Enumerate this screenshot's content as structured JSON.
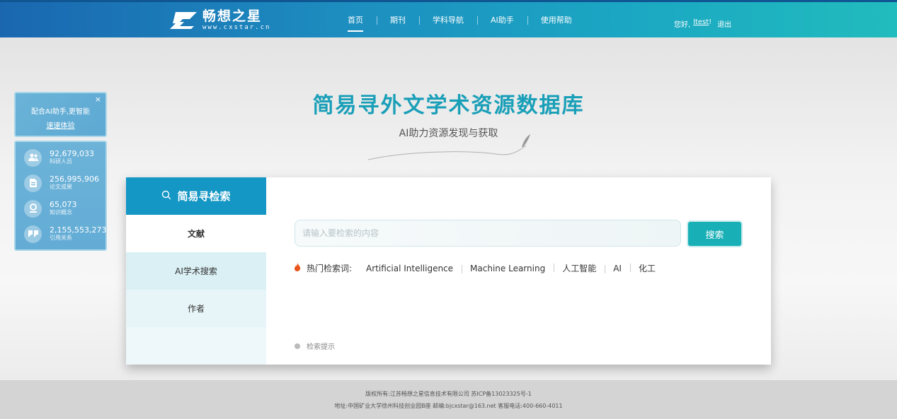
{
  "header": {
    "logo_cn": "畅想之星",
    "logo_url": "www.cxstar.cn",
    "nav": [
      "首页",
      "期刊",
      "学科导航",
      "AI助手",
      "使用帮助"
    ],
    "greeting": "您好,",
    "username": "ltest",
    "greeting_end": "!",
    "logout": "退出"
  },
  "promo": {
    "close": "×",
    "line1": "配合AI助手,更智能",
    "line2": "速速体验"
  },
  "stats": [
    {
      "icon": "users-icon",
      "value": "92,679,033",
      "label": "科研人员"
    },
    {
      "icon": "document-icon",
      "value": "256,995,906",
      "label": "论文成果"
    },
    {
      "icon": "concept-icon",
      "value": "65,073",
      "label": "知识概念"
    },
    {
      "icon": "quote-icon",
      "value": "2,155,553,273",
      "label": "引用关系"
    }
  ],
  "hero": {
    "title": "简易寻外文学术资源数据库",
    "subtitle": "AI助力资源发现与获取"
  },
  "search": {
    "panel_title": "简易寻检索",
    "tabs": [
      "文献",
      "AI学术搜索",
      "作者"
    ],
    "placeholder": "请输入要检索的内容",
    "button": "搜索",
    "hot_label": "热门检索词:",
    "hot_keywords": [
      "Artificial Intelligence",
      "Machine Learning",
      "人工智能",
      "AI",
      "化工"
    ],
    "tip": "检索提示"
  },
  "footer": {
    "line1": "版权所有:江苏畅想之星信息技术有限公司     苏ICP备13023325号-1",
    "line2": "地址:中国矿业大学徐州科技创业园B座     邮编:bjcxstar@163.net     客服电话:400-660-4011"
  },
  "colors": {
    "header_start": "#1a67b0",
    "header_end": "#21bcbd",
    "accent": "#1597c5",
    "search_button": "#18b0b6",
    "title": "#1a9fb8"
  }
}
